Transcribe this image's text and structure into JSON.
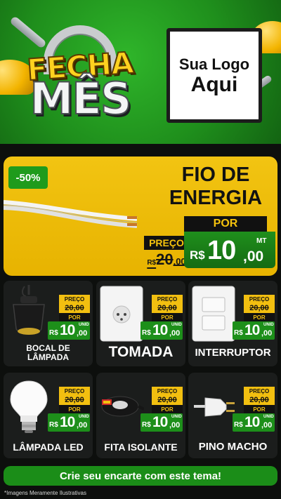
{
  "header": {
    "title_line1": "FECHA",
    "title_line2": "MÊS",
    "logo_line1": "Sua Logo",
    "logo_line2": "Aqui"
  },
  "feature": {
    "discount": "-50%",
    "title_line1": "FIO DE",
    "title_line2": "ENERGIA",
    "preco_label": "PREÇO",
    "old_currency": "R$",
    "old_int": "20",
    "old_cents": ",00",
    "por_label": "POR",
    "new_currency": "R$",
    "new_int": "10",
    "new_cents": ",00",
    "unit": "MT"
  },
  "products": [
    {
      "name_line1": "BOCAL DE",
      "name_line2": "LÂMPADA",
      "preco_label": "PREÇO",
      "old_price": "20,00",
      "por_label": "POR",
      "currency": "R$",
      "price_int": "10",
      "price_cents": ",00",
      "unit": "UNID"
    },
    {
      "name_line1": "TOMADA",
      "name_line2": "",
      "preco_label": "PREÇO",
      "old_price": "20,00",
      "por_label": "POR",
      "currency": "R$",
      "price_int": "10",
      "price_cents": ",00",
      "unit": "UNID"
    },
    {
      "name_line1": "INTERRUPTOR",
      "name_line2": "",
      "preco_label": "PREÇO",
      "old_price": "20,00",
      "por_label": "POR",
      "currency": "R$",
      "price_int": "10",
      "price_cents": ",00",
      "unit": "UNID"
    },
    {
      "name_line1": "LÂMPADA LED",
      "name_line2": "",
      "preco_label": "PREÇO",
      "old_price": "20,00",
      "por_label": "POR",
      "currency": "R$",
      "price_int": "10",
      "price_cents": ",00",
      "unit": "UNID"
    },
    {
      "name_line1": "FITA ISOLANTE",
      "name_line2": "",
      "preco_label": "PREÇO",
      "old_price": "20,00",
      "por_label": "POR",
      "currency": "R$",
      "price_int": "10",
      "price_cents": ",00",
      "unit": "UNID"
    },
    {
      "name_line1": "PINO MACHO",
      "name_line2": "",
      "preco_label": "PREÇO",
      "old_price": "20,00",
      "por_label": "POR",
      "currency": "R$",
      "price_int": "10",
      "price_cents": ",00",
      "unit": "UNID"
    }
  ],
  "footer": {
    "cta": "Crie seu encarte com este tema!",
    "disclaimer": "*Imagens Meramente Ilustrativas"
  },
  "colors": {
    "brand_green": "#1f8f1c",
    "accent_yellow": "#f2c412",
    "background": "#0d0f0d"
  },
  "icons": [
    "cable-image",
    "lamp-socket-image",
    "outlet-image",
    "light-switch-image",
    "led-bulb-image",
    "insulating-tape-image",
    "plug-image",
    "padlock-image",
    "helmet-image",
    "wrench-image"
  ]
}
